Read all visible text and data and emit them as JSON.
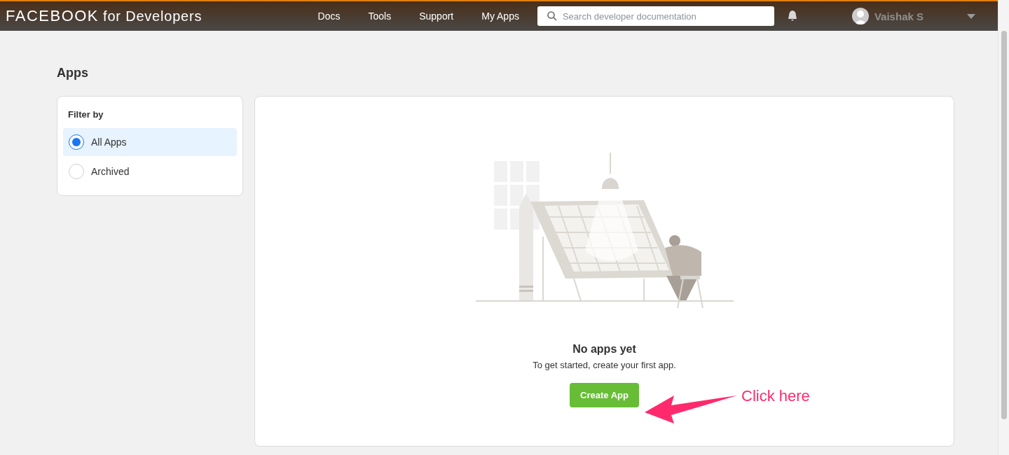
{
  "header": {
    "logo_brand": "FACEBOOK",
    "logo_suffix": "for Developers",
    "nav": [
      "Docs",
      "Tools",
      "Support",
      "My Apps"
    ],
    "search": {
      "placeholder": "Search developer documentation"
    },
    "user": {
      "name": "Vaishak S"
    }
  },
  "page": {
    "title": "Apps"
  },
  "filter": {
    "title": "Filter by",
    "options": [
      {
        "label": "All Apps",
        "selected": true
      },
      {
        "label": "Archived",
        "selected": false
      }
    ]
  },
  "empty_state": {
    "title": "No apps yet",
    "subtitle": "To get started, create your first app.",
    "button": "Create App"
  },
  "annotation": {
    "text": "Click here"
  }
}
